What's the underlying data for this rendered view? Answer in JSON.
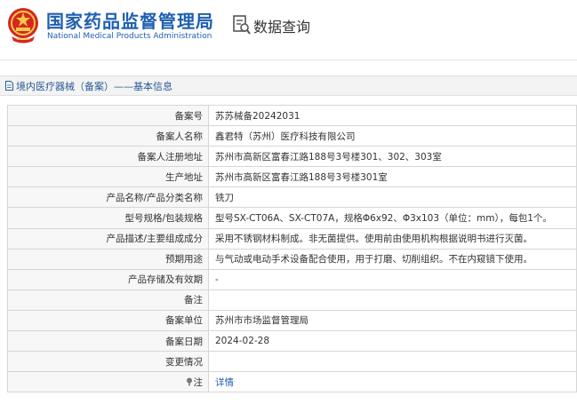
{
  "header": {
    "brand_cn": "国家药品监督管理局",
    "brand_en": "National Medical Products Administration",
    "data_query": "数据查询"
  },
  "section": {
    "title": "境内医疗器械（备案）——基本信息"
  },
  "rows": [
    {
      "label": "备案号",
      "value": "苏苏械备20242031"
    },
    {
      "label": "备案人名称",
      "value": "鑫君特（苏州）医疗科技有限公司"
    },
    {
      "label": "备案人注册地址",
      "value": "苏州市高新区富春江路188号3号楼301、302、303室"
    },
    {
      "label": "生产地址",
      "value": "苏州市高新区富春江路188号3号楼301室"
    },
    {
      "label": "产品名称/产品分类名称",
      "value": "铣刀"
    },
    {
      "label": "型号规格/包装规格",
      "value": "型号SX-CT06A、SX-CT07A，规格Φ6x92、Φ3x103（单位：mm），每包1个。"
    },
    {
      "label": "产品描述/主要组成成分",
      "value": "采用不锈钢材料制成。非无菌提供。使用前由使用机构根据说明书进行灭菌。"
    },
    {
      "label": "预期用途",
      "value": "与气动或电动手术设备配合使用，用于打磨、切削组织。不在内窥镜下使用。"
    },
    {
      "label": "产品存储及有效期",
      "value": "-"
    },
    {
      "label": "备注",
      "value": ""
    },
    {
      "label": "备案单位",
      "value": "苏州市市场监督管理局"
    },
    {
      "label": "备案日期",
      "value": "2024-02-28"
    },
    {
      "label": "变更情况",
      "value": ""
    },
    {
      "label": "注",
      "value": "详情"
    }
  ],
  "colors": {
    "brand_blue": "#1f5fb0",
    "emblem_red": "#d7261e",
    "emblem_gold": "#f2c94c",
    "link_blue": "#1f5fb0"
  },
  "icons": [
    "national-emblem-icon",
    "search-document-icon",
    "document-icon",
    "note-icon"
  ]
}
